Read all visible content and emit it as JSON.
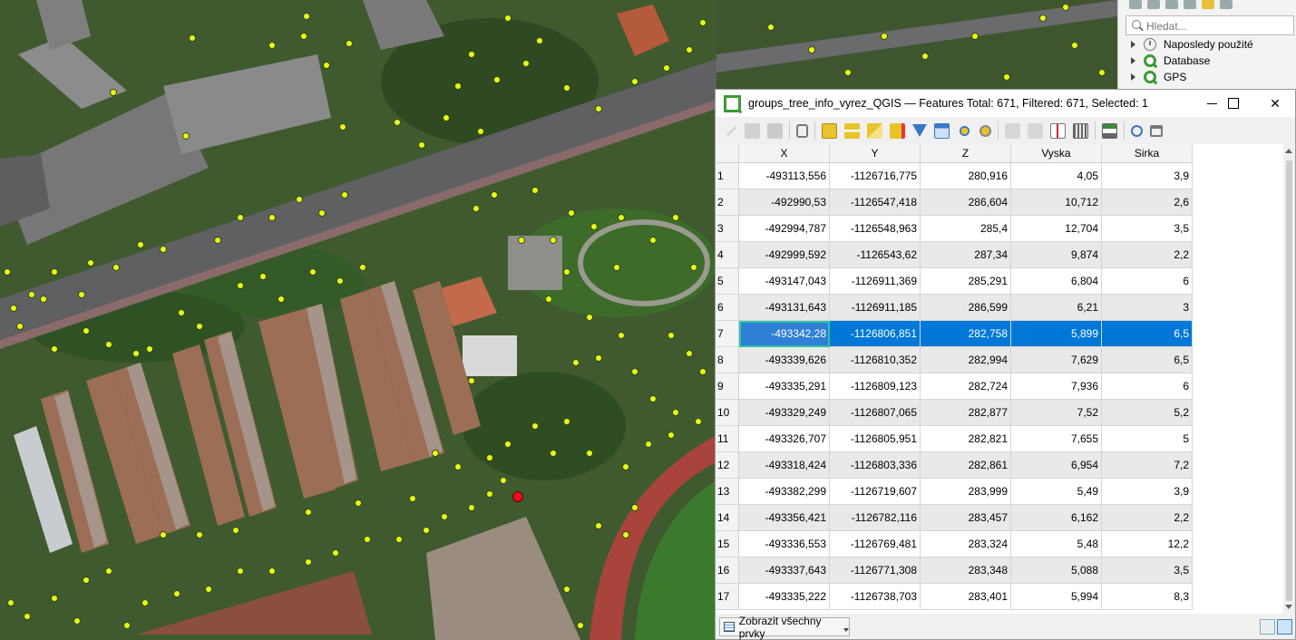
{
  "browser": {
    "search_placeholder": "Hledat...",
    "items": [
      {
        "label": "Naposledy použité",
        "icon": "clock-icon"
      },
      {
        "label": "Database",
        "icon": "qgis-logo-icon"
      },
      {
        "label": "GPS",
        "icon": "qgis-logo-icon"
      }
    ]
  },
  "window": {
    "title": "groups_tree_info_vyrez_QGIS — Features Total: 671, Filtered: 671, Selected: 1",
    "minimize_icon": "minimize-icon",
    "maximize_icon": "maximize-icon",
    "close_label": "✕"
  },
  "table": {
    "columns": [
      "X",
      "Y",
      "Z",
      "Vyska",
      "Sirka"
    ],
    "selected_row": 7,
    "rows": [
      {
        "n": "1",
        "x": "-493113,556",
        "y": "-1126716,775",
        "z": "280,916",
        "vyska": "4,05",
        "sirka": "3,9"
      },
      {
        "n": "2",
        "x": "-492990,53",
        "y": "-1126547,418",
        "z": "286,604",
        "vyska": "10,712",
        "sirka": "2,6"
      },
      {
        "n": "3",
        "x": "-492994,787",
        "y": "-1126548,963",
        "z": "285,4",
        "vyska": "12,704",
        "sirka": "3,5"
      },
      {
        "n": "4",
        "x": "-492999,592",
        "y": "-1126543,62",
        "z": "287,34",
        "vyska": "9,874",
        "sirka": "2,2"
      },
      {
        "n": "5",
        "x": "-493147,043",
        "y": "-1126911,369",
        "z": "285,291",
        "vyska": "6,804",
        "sirka": "6"
      },
      {
        "n": "6",
        "x": "-493131,643",
        "y": "-1126911,185",
        "z": "286,599",
        "vyska": "6,21",
        "sirka": "3"
      },
      {
        "n": "7",
        "x": "-493342,28",
        "y": "-1126806,851",
        "z": "282,758",
        "vyska": "5,899",
        "sirka": "6,5"
      },
      {
        "n": "8",
        "x": "-493339,626",
        "y": "-1126810,352",
        "z": "282,994",
        "vyska": "7,629",
        "sirka": "6,5"
      },
      {
        "n": "9",
        "x": "-493335,291",
        "y": "-1126809,123",
        "z": "282,724",
        "vyska": "7,936",
        "sirka": "6"
      },
      {
        "n": "10",
        "x": "-493329,249",
        "y": "-1126807,065",
        "z": "282,877",
        "vyska": "7,52",
        "sirka": "5,2"
      },
      {
        "n": "11",
        "x": "-493326,707",
        "y": "-1126805,951",
        "z": "282,821",
        "vyska": "7,655",
        "sirka": "5"
      },
      {
        "n": "12",
        "x": "-493318,424",
        "y": "-1126803,336",
        "z": "282,861",
        "vyska": "6,954",
        "sirka": "7,2"
      },
      {
        "n": "13",
        "x": "-493382,299",
        "y": "-1126719,607",
        "z": "283,999",
        "vyska": "5,49",
        "sirka": "3,9"
      },
      {
        "n": "14",
        "x": "-493356,421",
        "y": "-1126782,116",
        "z": "283,457",
        "vyska": "6,162",
        "sirka": "2,2"
      },
      {
        "n": "15",
        "x": "-493336,553",
        "y": "-1126769,481",
        "z": "283,324",
        "vyska": "5,48",
        "sirka": "12,2"
      },
      {
        "n": "16",
        "x": "-493337,643",
        "y": "-1126771,308",
        "z": "283,348",
        "vyska": "5,088",
        "sirka": "3,5"
      },
      {
        "n": "17",
        "x": "-493335,222",
        "y": "-1126738,703",
        "z": "283,401",
        "vyska": "5,994",
        "sirka": "8,3"
      }
    ]
  },
  "bottom": {
    "filter_label": "Zobrazit všechny prvky"
  },
  "colors": {
    "selection": "#0078d7",
    "point_fill": "#e8ff1a",
    "selected_point": "#e8101a",
    "qgis_green": "#3c9a37"
  }
}
